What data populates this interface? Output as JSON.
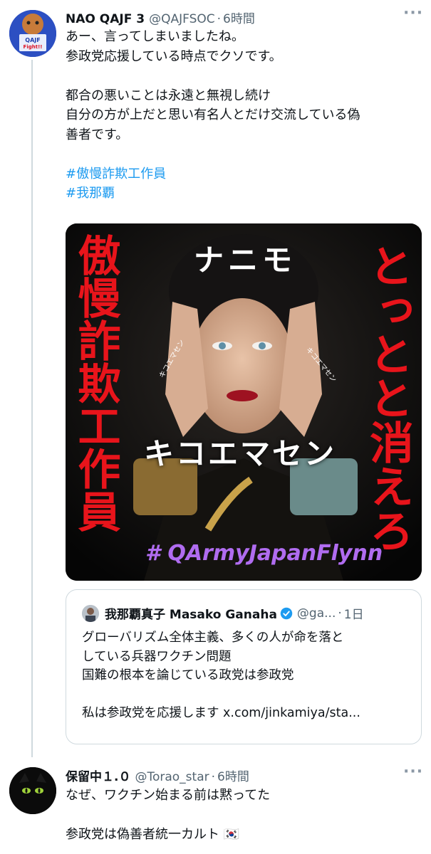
{
  "tweets": [
    {
      "name": "NAO QAJF 3",
      "handle": "@QAJFSOC",
      "separator": "·",
      "time": "6時間",
      "avatar": {
        "label": "QAJF",
        "sublabel": "Fight!!"
      },
      "more_icon": "more-icon",
      "body": [
        "あー、言ってしまいましたね。",
        "参政党応援している時点でクソです。",
        "",
        "都合の悪いことは永遠と無視し続け",
        "自分の方が上だと思い有名人とだけ交流している偽",
        "善者です。",
        ""
      ],
      "hashtags": [
        "#傲慢詐欺工作員",
        "#我那覇"
      ],
      "image": {
        "left_text": "傲慢詐欺工作員",
        "right_text": "とっとと消えろ",
        "top_text": "ナニモ",
        "middle_text": "キコエマセン",
        "small_text": "キコエマセン",
        "hashtag_overlay": "# QArmyJapanFlynn"
      },
      "quote": {
        "name": "我那覇真子 Masako Ganaha",
        "verified_icon": "verified-badge-icon",
        "handle": "@ga...",
        "separator": "·",
        "time": "1日",
        "body": [
          "グローバリズム全体主義、多くの人が命を落と",
          "している兵器ワクチン問題",
          "国難の根本を論じている政党は参政党",
          "",
          "私は参政党を応援します x.com/jinkamiya/sta..."
        ]
      }
    },
    {
      "name": "保留中１.０",
      "handle": "@Torao_star",
      "separator": "·",
      "time": "6時間",
      "more_icon": "more-icon",
      "body": [
        "なぜ、ワクチン始まる前は黙ってた",
        "",
        "参政党は偽善者統一カルト 🇰🇷"
      ]
    }
  ],
  "colors": {
    "link": "#1d9bf0",
    "muted": "#536471",
    "red_text": "#e8141b",
    "overlay_purple": "#b06cf0"
  }
}
